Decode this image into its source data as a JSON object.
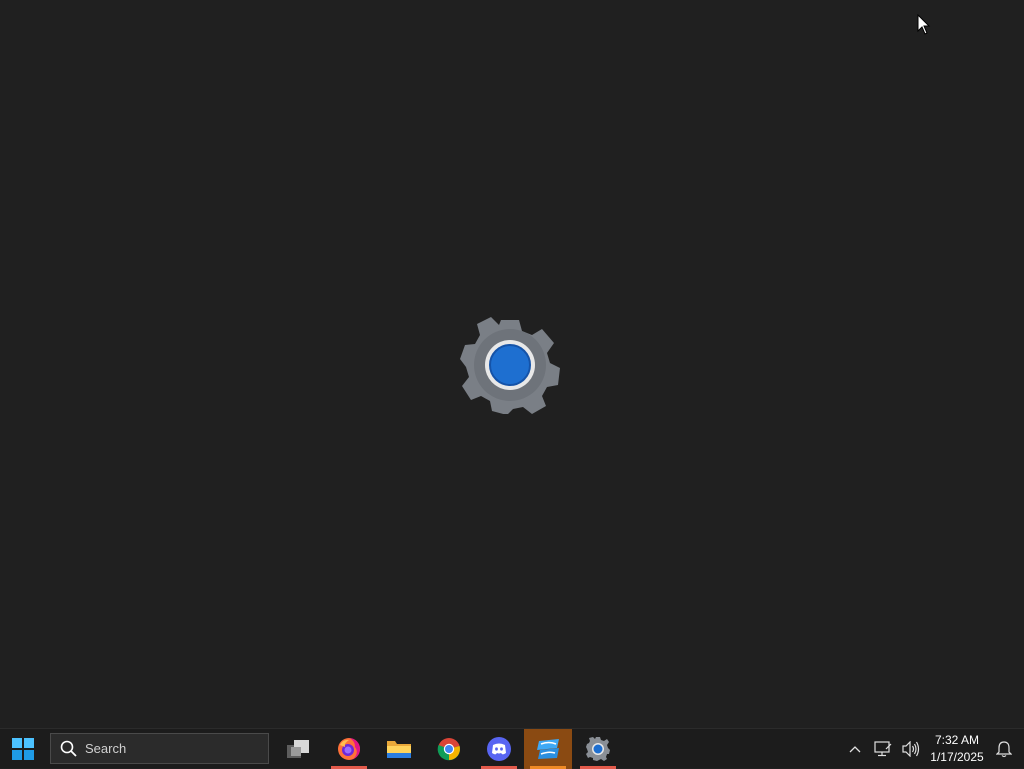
{
  "desktop": {
    "background": "#202020",
    "splash_icon": "settings-gear-icon"
  },
  "taskbar": {
    "start_icon": "windows-start-icon",
    "search": {
      "label": "Search",
      "icon": "search-icon"
    },
    "apps": [
      {
        "name": "Task View",
        "icon": "task-view-icon",
        "running": false
      },
      {
        "name": "Firefox",
        "icon": "firefox-icon",
        "running": true
      },
      {
        "name": "File Explorer",
        "icon": "file-explorer-icon",
        "running": false
      },
      {
        "name": "Google Chrome",
        "icon": "chrome-icon",
        "running": false
      },
      {
        "name": "Discord",
        "icon": "discord-icon",
        "running": true
      },
      {
        "name": "Roblox",
        "icon": "roblox-icon",
        "running": true,
        "active": true
      },
      {
        "name": "Settings",
        "icon": "settings-icon",
        "running": true
      }
    ],
    "tray": {
      "overflow_icon": "chevron-up-icon",
      "network_icon": "network-icon",
      "volume_icon": "volume-icon",
      "notification_icon": "notification-bell-icon"
    },
    "clock": {
      "time": "7:32 AM",
      "date": "1/17/2025"
    }
  },
  "colors": {
    "accent_blue": "#1e6fd0",
    "active_app": "#8a4a12",
    "indicator": "#e35a4b"
  }
}
